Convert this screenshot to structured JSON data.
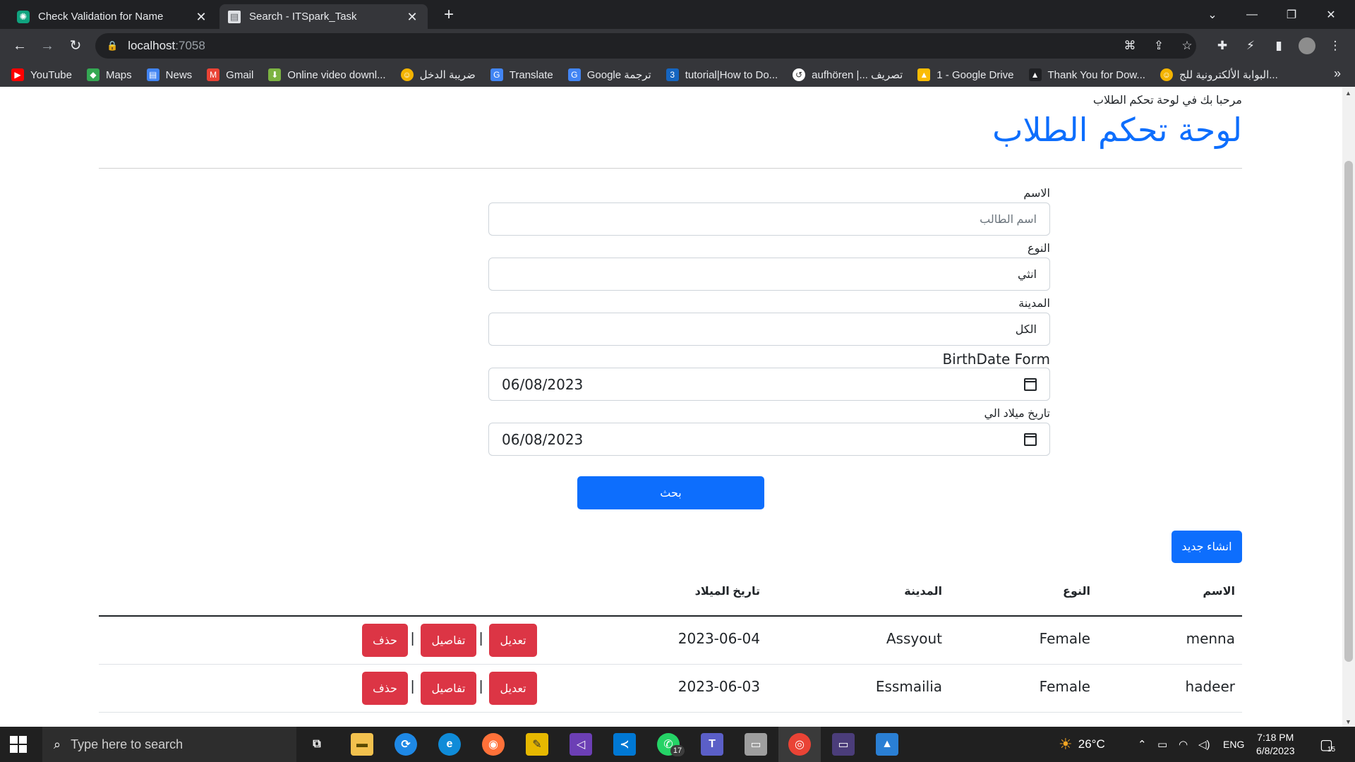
{
  "browser": {
    "tabs": [
      {
        "title": "Check Validation for Name",
        "active": false
      },
      {
        "title": "Search - ITSpark_Task",
        "active": true
      }
    ],
    "url_host": "localhost",
    "url_port": ":7058",
    "bookmarks": [
      {
        "label": "YouTube",
        "icon": "youtube-icon",
        "color": "#ff0000"
      },
      {
        "label": "Maps",
        "icon": "maps-icon",
        "color": "#34a853"
      },
      {
        "label": "News",
        "icon": "news-icon",
        "color": "#4285f4"
      },
      {
        "label": "Gmail",
        "icon": "gmail-icon",
        "color": "#ea4335"
      },
      {
        "label": "Online video downl...",
        "icon": "download-icon",
        "color": "#7cb342"
      },
      {
        "label": "ضريبة الدخل",
        "icon": "emoji-icon",
        "color": "#f4b400"
      },
      {
        "label": "Translate",
        "icon": "translate-icon",
        "color": "#4285f4"
      },
      {
        "label": "Google ترجمة",
        "icon": "translate-icon",
        "color": "#4285f4"
      },
      {
        "label": "tutorial|How to Do...",
        "icon": "w3-icon",
        "color": "#1565c0"
      },
      {
        "label": "aufhören |... تصريف",
        "icon": "reverso-icon",
        "color": "#ffffff"
      },
      {
        "label": "1 - Google Drive",
        "icon": "drive-icon",
        "color": "#fbbc04"
      },
      {
        "label": "Thank You for Dow...",
        "icon": "triangle-icon",
        "color": "#202124"
      },
      {
        "label": "البوابة الألكترونية للج...",
        "icon": "emoji-icon",
        "color": "#f4b400"
      }
    ]
  },
  "page": {
    "welcome": "مرحبا بك في لوحة تحكم الطلاب",
    "title": "لوحة تحكم الطلاب",
    "form": {
      "name_label": "الاسم",
      "name_placeholder": "اسم الطالب",
      "gender_label": "النوع",
      "gender_value": "انثي",
      "city_label": "المدينة",
      "city_value": "الكل",
      "birth_from_label": "BirthDate Form",
      "birth_from_value": "06/08/2023",
      "birth_to_label": "تاريخ ميلاد الي",
      "birth_to_value": "06/08/2023",
      "search_button": "بحث"
    },
    "create_button": "انشاء جديد",
    "table": {
      "headers": {
        "name": "الاسم",
        "gender": "النوع",
        "city": "المدينة",
        "birthdate": "تاريخ الميلاد"
      },
      "rows": [
        {
          "name": "menna",
          "gender": "Female",
          "city": "Assyout",
          "birthdate": "2023-06-04"
        },
        {
          "name": "hadeer",
          "gender": "Female",
          "city": "Essmailia",
          "birthdate": "2023-06-03"
        }
      ],
      "actions": {
        "edit": "تعديل",
        "details": "تفاصيل",
        "delete": "حذف",
        "separator": "|"
      }
    },
    "colors": {
      "primary": "#0d6efd",
      "danger": "#dc3545"
    }
  },
  "taskbar": {
    "search_placeholder": "Type here to search",
    "weather": "26°C",
    "language": "ENG",
    "time": "7:18 PM",
    "date": "6/8/2023",
    "notification_count": "15",
    "whatsapp_badge": "17"
  }
}
